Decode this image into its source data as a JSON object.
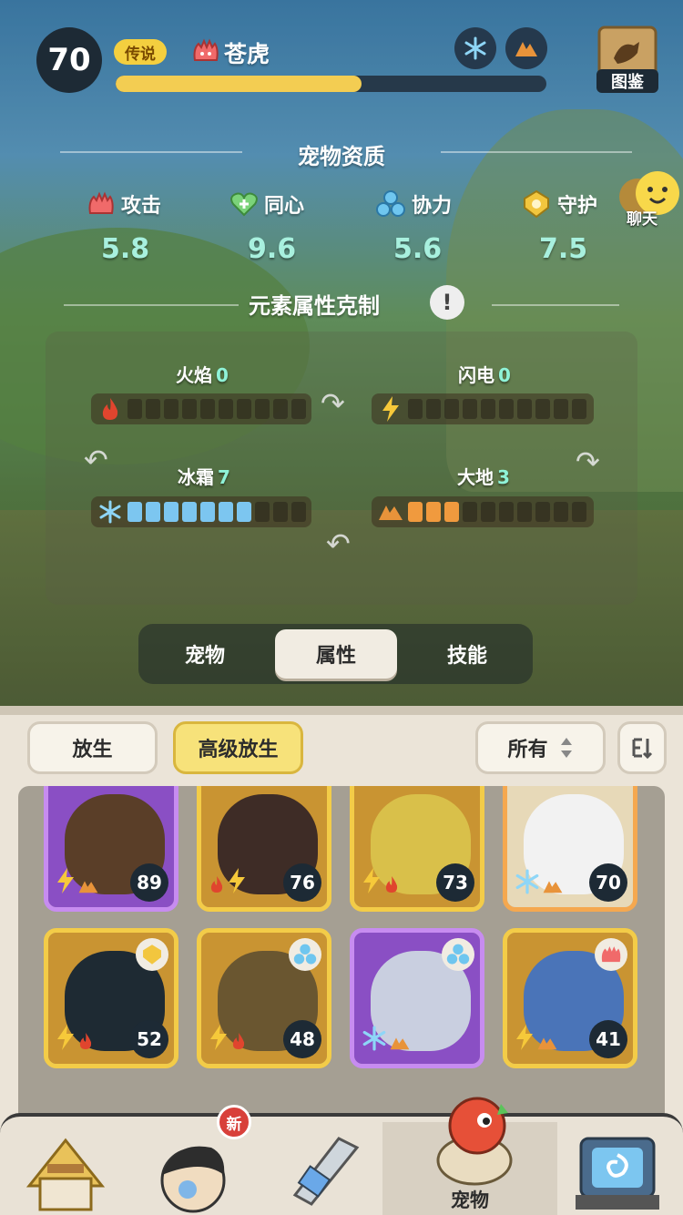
{
  "header": {
    "level": "70",
    "rarity": "传说",
    "pet_name": "苍虎",
    "xp_fraction": 0.57,
    "dex_label": "图鉴",
    "element_buttons": [
      "frost-icon",
      "earth-icon"
    ]
  },
  "qualities": {
    "title": "宠物资质",
    "items": [
      {
        "label": "攻击",
        "value": "5.8",
        "icon": "attack-icon"
      },
      {
        "label": "同心",
        "value": "9.6",
        "icon": "heart-icon"
      },
      {
        "label": "协力",
        "value": "5.6",
        "icon": "cooperate-icon"
      },
      {
        "label": "守护",
        "value": "7.5",
        "icon": "guard-icon"
      }
    ]
  },
  "chat_label": "聊天",
  "elements": {
    "title": "元素属性克制",
    "info_symbol": "!",
    "items": [
      {
        "name": "火焰",
        "count": "0",
        "filled": 0,
        "total": 10,
        "icon": "fire-icon"
      },
      {
        "name": "闪电",
        "count": "0",
        "filled": 0,
        "total": 10,
        "icon": "lightning-icon"
      },
      {
        "name": "冰霜",
        "count": "7",
        "filled": 7,
        "total": 10,
        "icon": "frost-icon"
      },
      {
        "name": "大地",
        "count": "3",
        "filled": 3,
        "total": 10,
        "icon": "earth-icon"
      }
    ]
  },
  "tabs": [
    {
      "label": "宠物",
      "active": false
    },
    {
      "label": "属性",
      "active": true
    },
    {
      "label": "技能",
      "active": false
    }
  ],
  "toolbar": {
    "release": "放生",
    "advanced_release": "高级放生",
    "filter": "所有",
    "filter_icon": "sort-updown-icon",
    "sort_icon": "sort-icon"
  },
  "pets": [
    {
      "level": "89",
      "frame": "purple",
      "elems": [
        "lightning",
        "earth"
      ],
      "corner": ""
    },
    {
      "level": "76",
      "frame": "gold",
      "elems": [
        "fire",
        "lightning"
      ],
      "corner": ""
    },
    {
      "level": "73",
      "frame": "gold",
      "elems": [
        "lightning",
        "fire"
      ],
      "corner": ""
    },
    {
      "level": "70",
      "frame": "orange",
      "elems": [
        "frost",
        "earth"
      ],
      "corner": ""
    },
    {
      "level": "52",
      "frame": "gold",
      "elems": [
        "lightning",
        "fire"
      ],
      "corner": "guard"
    },
    {
      "level": "48",
      "frame": "gold",
      "elems": [
        "lightning",
        "fire"
      ],
      "corner": "cooperate"
    },
    {
      "level": "",
      "frame": "purple",
      "elems": [
        "frost",
        "earth"
      ],
      "corner": "cooperate"
    },
    {
      "level": "41",
      "frame": "gold",
      "elems": [
        "lightning",
        "earth"
      ],
      "corner": "attack"
    }
  ],
  "nav": {
    "active_label": "宠物",
    "new_badge": "新"
  }
}
